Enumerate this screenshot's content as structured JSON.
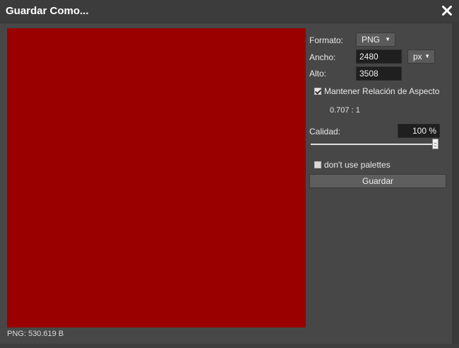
{
  "dialog": {
    "title": "Guardar Como...",
    "close_glyph": "✕"
  },
  "preview": {
    "color": "#9b0000",
    "info": "PNG: 530.619 B"
  },
  "panel": {
    "format_label": "Formato:",
    "format_value": "PNG",
    "width_label": "Ancho:",
    "width_value": "2480",
    "unit_value": "px",
    "height_label": "Alto:",
    "height_value": "3508",
    "keep_aspect_label": "Mantener Relación de Aspecto",
    "keep_aspect_checked": true,
    "aspect_ratio": "0.707 : 1",
    "quality_label": "Calidad:",
    "quality_value": "100 %",
    "quality_percent": 100,
    "no_palettes_label": "don't use palettes",
    "no_palettes_checked": false,
    "save_label": "Guardar"
  }
}
